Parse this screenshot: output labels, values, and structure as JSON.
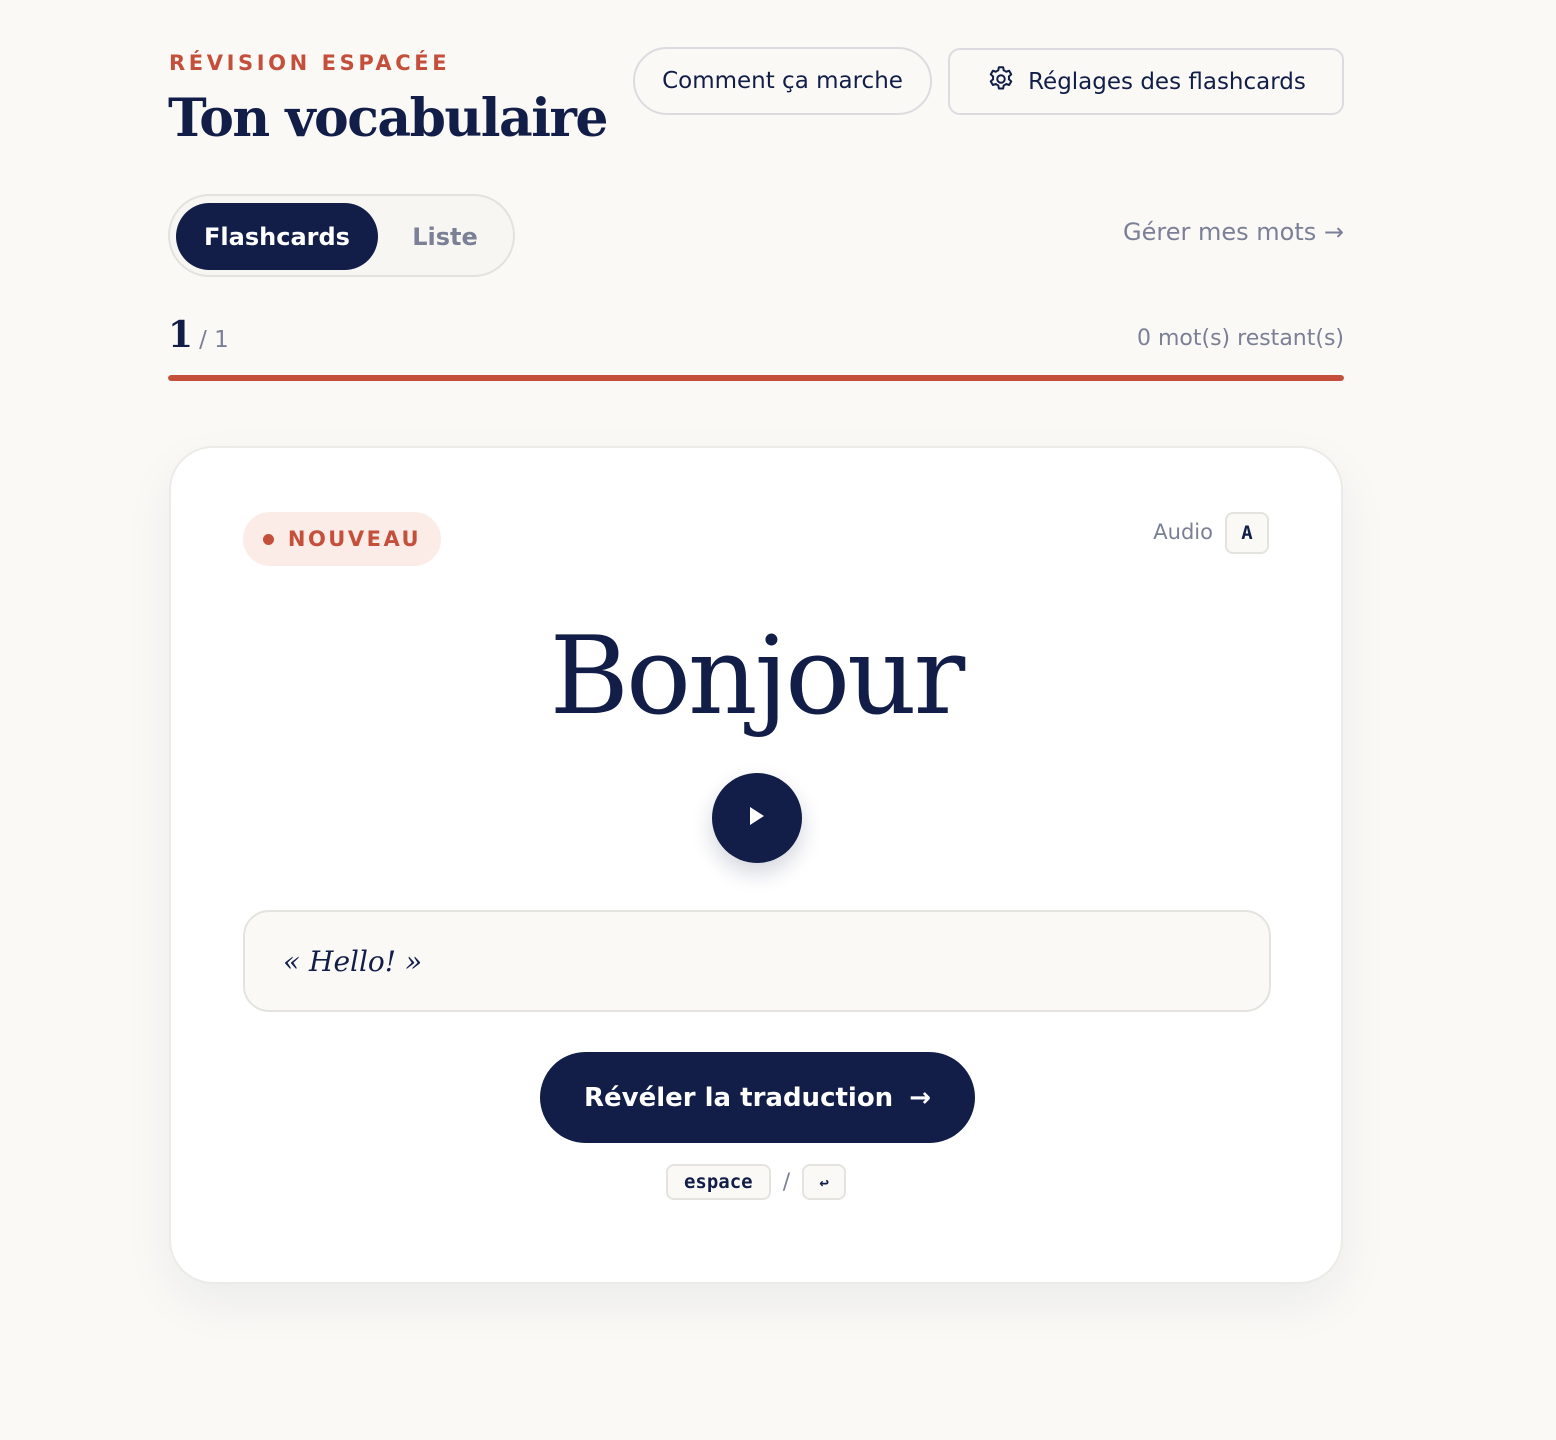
{
  "header": {
    "eyebrow": "RÉVISION ESPACÉE",
    "title": "Ton vocabulaire",
    "how_it_works_label": "Comment ça marche",
    "settings_label": "Réglages des flashcards"
  },
  "view_toggle": {
    "active": "Flashcards",
    "inactive": "Liste"
  },
  "manage_link": "Gérer mes mots →",
  "progress": {
    "current": "1",
    "total_text": "/ 1",
    "remaining_text": "0 mot(s) restant(s)",
    "fraction": 1.0
  },
  "card": {
    "badge_label": "NOUVEAU",
    "audio_label": "Audio",
    "audio_key": "A",
    "word": "Bonjour",
    "example": "« Hello! »",
    "reveal_label": "Révéler la traduction",
    "reveal_arrow": "→",
    "shortcut_key_1": "espace",
    "shortcut_separator": "/",
    "shortcut_key_2": "↩"
  },
  "colors": {
    "accent": "#c4503c",
    "navy": "#121e48",
    "muted": "#7c8096",
    "background": "#faf9f6"
  },
  "icons": {
    "settings": "gear-icon",
    "play": "play-icon"
  }
}
